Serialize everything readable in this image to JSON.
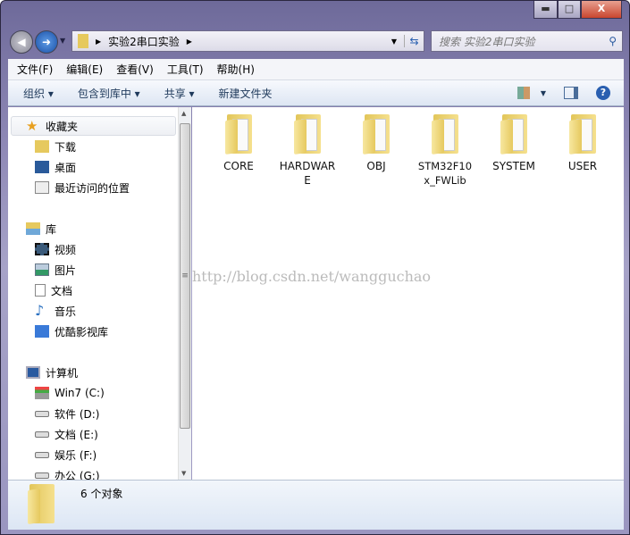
{
  "window": {
    "minimize": "▬",
    "maximize": "□",
    "close": "X"
  },
  "address": {
    "path": "实验2串口实验",
    "search_placeholder": "搜索 实验2串口实验"
  },
  "menu": [
    "文件(F)",
    "编辑(E)",
    "查看(V)",
    "工具(T)",
    "帮助(H)"
  ],
  "toolbar": {
    "organize": "组织 ▾",
    "include_library": "包含到库中 ▾",
    "share": "共享 ▾",
    "new_folder": "新建文件夹"
  },
  "sidebar": {
    "favorites": {
      "label": "收藏夹",
      "items": [
        "下载",
        "桌面",
        "最近访问的位置"
      ]
    },
    "libraries": {
      "label": "库",
      "items": [
        "视频",
        "图片",
        "文档",
        "音乐",
        "优酷影视库"
      ]
    },
    "computer": {
      "label": "计算机",
      "items": [
        "Win7 (C:)",
        "软件 (D:)",
        "文档 (E:)",
        "娱乐 (F:)",
        "办公 (G:)"
      ]
    }
  },
  "folders": [
    "CORE",
    "HARDWARE",
    "OBJ",
    "STM32F10x_FWLib",
    "SYSTEM",
    "USER"
  ],
  "watermark": "http://blog.csdn.net/wangguchao",
  "status": {
    "count": "6 个对象"
  }
}
